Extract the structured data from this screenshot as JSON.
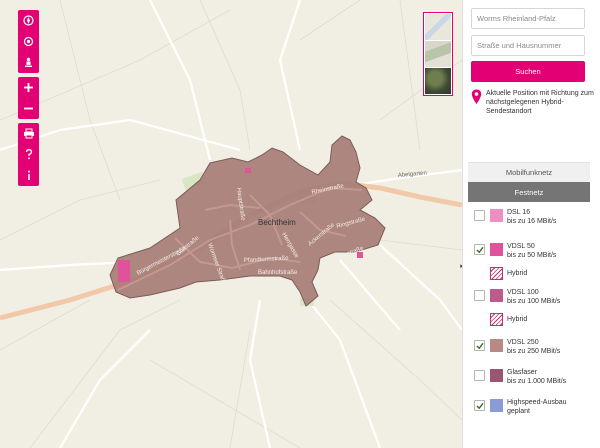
{
  "search": {
    "location_value": "Worms Rheinland-Pfalz",
    "street_placeholder": "Straße und Hausnummer",
    "button_label": "Suchen"
  },
  "locate": {
    "text": "Aktuelle Position mit Richtung zum nächstgelegenen Hybrid-Sendestandort"
  },
  "tabs": {
    "mobile": "Mobilfunknetz",
    "fixed": "Festnetz"
  },
  "legend": [
    {
      "title": "DSL 16",
      "subtitle": "bis zu 16 MBit/s",
      "checked": false,
      "color": "#ee8fc3"
    },
    {
      "title": "VDSL 50",
      "subtitle": "bis zu 50 MBit/s",
      "checked": true,
      "color": "#e0539a",
      "hybrid": "Hybrid"
    },
    {
      "title": "VDSL 100",
      "subtitle": "bis zu 100 MBit/s",
      "checked": false,
      "color": "#bd5a8e",
      "hybrid": "Hybrid"
    },
    {
      "title": "VDSL 250",
      "subtitle": "bis zu 250 MBit/s",
      "checked": true,
      "color": "#b78b84"
    },
    {
      "title": "Glasfaser",
      "subtitle": "bis zu 1.000 MBit/s",
      "checked": false,
      "color": "#9a5573"
    },
    {
      "title": "Highspeed-Ausbau",
      "subtitle": "geplant",
      "checked": true,
      "color": "#8b9bd5"
    }
  ],
  "map": {
    "town": "Bechtheim",
    "roads": [
      "Rheinstraße",
      "Hauptstraße",
      "Pfandturmstraße",
      "Bahnhofstraße",
      "Weinstraße",
      "Bürgermeisterstraße",
      "Gollstraße",
      "Wormser Straße",
      "Ringstraße",
      "Ackerstraße",
      "Herrgasse",
      "Abelgarten"
    ]
  },
  "colors": {
    "accent": "#e20074",
    "coverage": "#a67d76",
    "coverage_edge": "#7d5c57"
  },
  "toolbar_icons": [
    "compass-icon",
    "locate-icon",
    "person-icon",
    "zoom-in-icon",
    "zoom-out-icon",
    "print-icon",
    "help-icon",
    "info-icon"
  ]
}
